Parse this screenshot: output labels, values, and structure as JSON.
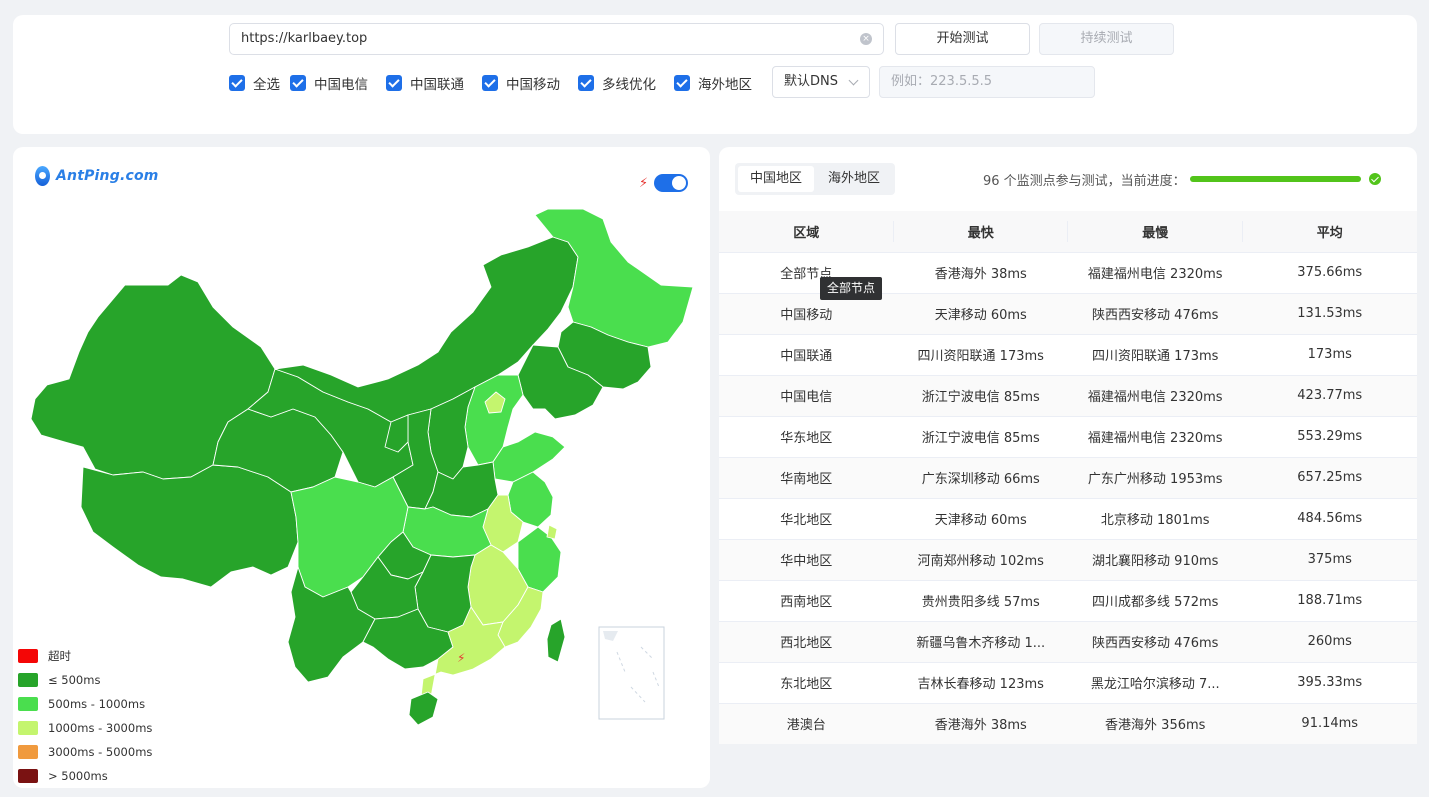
{
  "top": {
    "url_value": "https://karlbaey.top",
    "start_button": "开始测试",
    "continue_button": "持续测试",
    "checkboxes": [
      {
        "label": "全选",
        "checked": true
      },
      {
        "label": "中国电信",
        "checked": true
      },
      {
        "label": "中国联通",
        "checked": true
      },
      {
        "label": "中国移动",
        "checked": true
      },
      {
        "label": "多线优化",
        "checked": true
      },
      {
        "label": "海外地区",
        "checked": true
      }
    ],
    "dns_select": "默认DNS",
    "dns_placeholder": "例如：223.5.5.5"
  },
  "map": {
    "logo_text": "AntPing.com",
    "legend": [
      {
        "label": "超时",
        "color": "#f40606"
      },
      {
        "label": "≤ 500ms",
        "color": "#27a42a"
      },
      {
        "label": "500ms - 1000ms",
        "color": "#4ade4e"
      },
      {
        "label": "1000ms - 3000ms",
        "color": "#c4f56e"
      },
      {
        "label": "3000ms - 5000ms",
        "color": "#f09a3e"
      },
      {
        "label": "> 5000ms",
        "color": "#7a1212"
      }
    ]
  },
  "results": {
    "tabs": [
      "中国地区",
      "海外地区"
    ],
    "progress_text": "96 个监测点参与测试，当前进度：",
    "progress": 1.0,
    "tooltip": "全部节点",
    "headers": [
      "区域",
      "最快",
      "最慢",
      "平均"
    ],
    "rows": [
      [
        "全部节点",
        "香港海外 38ms",
        "福建福州电信 2320ms",
        "375.66ms"
      ],
      [
        "中国移动",
        "天津移动 60ms",
        "陕西西安移动 476ms",
        "131.53ms"
      ],
      [
        "中国联通",
        "四川资阳联通 173ms",
        "四川资阳联通 173ms",
        "173ms"
      ],
      [
        "中国电信",
        "浙江宁波电信 85ms",
        "福建福州电信 2320ms",
        "423.77ms"
      ],
      [
        "华东地区",
        "浙江宁波电信 85ms",
        "福建福州电信 2320ms",
        "553.29ms"
      ],
      [
        "华南地区",
        "广东深圳移动 66ms",
        "广东广州移动 1953ms",
        "657.25ms"
      ],
      [
        "华北地区",
        "天津移动 60ms",
        "北京移动 1801ms",
        "484.56ms"
      ],
      [
        "华中地区",
        "河南郑州移动 102ms",
        "湖北襄阳移动 910ms",
        "375ms"
      ],
      [
        "西南地区",
        "贵州贵阳多线 57ms",
        "四川成都多线 572ms",
        "188.71ms"
      ],
      [
        "西北地区",
        "新疆乌鲁木齐移动 1...",
        "陕西西安移动 476ms",
        "260ms"
      ],
      [
        "东北地区",
        "吉林长春移动 123ms",
        "黑龙江哈尔滨移动 7...",
        "395.33ms"
      ],
      [
        "港澳台",
        "香港海外 38ms",
        "香港海外 356ms",
        "91.14ms"
      ]
    ]
  }
}
